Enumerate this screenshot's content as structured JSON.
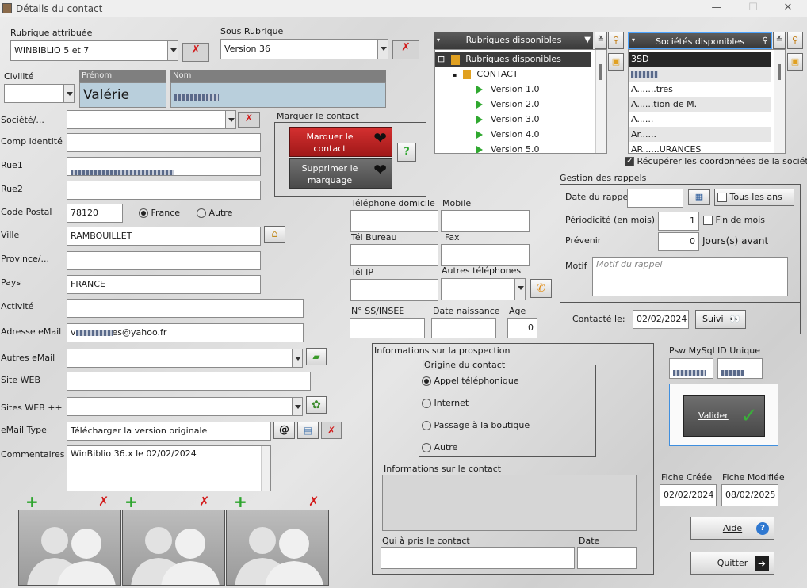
{
  "window": {
    "title": "Détails du contact"
  },
  "rubrique": {
    "label": "Rubrique attribuée",
    "value": "WINBIBLIO 5 et 7"
  },
  "sous_rubrique": {
    "label": "Sous Rubrique",
    "value": "Version 36"
  },
  "civilite": {
    "label": "Civilité",
    "value": ""
  },
  "prenom": {
    "label": "Prénom",
    "value": "Valérie"
  },
  "nom": {
    "label": "Nom"
  },
  "marquer": {
    "group_label": "Marquer le contact",
    "mark_btn": "Marquer le contact",
    "unmark_btn": "Supprimer le marquage",
    "help": "?"
  },
  "fields": {
    "societe": "Société/...",
    "comp_identite": "Comp identité",
    "rue1": "Rue1",
    "rue2": "Rue2",
    "code_postal": "Code Postal",
    "code_postal_value": "78120",
    "france": "France",
    "autre": "Autre",
    "ville": "Ville",
    "ville_value": "RAMBOUILLET",
    "province": "Province/...",
    "pays": "Pays",
    "pays_value": "FRANCE",
    "activite": "Activité",
    "email": "Adresse eMail",
    "email_value_suffix": "es@yahoo.fr",
    "autres_email": "Autres eMail",
    "site_web": "Site WEB",
    "sites_web": "Sites WEB ++",
    "email_type": "eMail Type",
    "email_type_value": "Télécharger la version originale",
    "commentaires": "Commentaires",
    "commentaires_value": "WinBiblio 36.x le 02/02/2024"
  },
  "phones": {
    "tel_domicile": "Téléphone domicile",
    "mobile": "Mobile",
    "tel_bureau": "Tél Bureau",
    "fax": "Fax",
    "tel_ip": "Tél IP",
    "autres_tel": "Autres téléphones",
    "ss": "N° SS/INSEE",
    "date_naissance": "Date naissance",
    "age": "Age",
    "age_value": "0"
  },
  "rubriques_panel": {
    "header": "Rubriques disponibles",
    "root": "Rubriques disponibles",
    "node": "CONTACT",
    "items": [
      "Version 1.0",
      "Version 2.0",
      "Version 3.0",
      "Version 4.0",
      "Version 5.0"
    ]
  },
  "societes_panel": {
    "header": "Sociétés disponibles",
    "items": [
      "3SD",
      "",
      "A.......tres",
      "A......tion de M.",
      "A......",
      "Ar......",
      "AR......URANCES"
    ]
  },
  "recuperer": "Récupérer les coordonnées de la société",
  "rappels": {
    "title": "Gestion des rappels",
    "date_label": "Date du rappel",
    "tous_les_ans": "Tous les ans",
    "periodicite": "Périodicité (en mois)",
    "periodicite_value": "1",
    "fin_de_mois": "Fin de mois",
    "prevenir": "Prévenir",
    "prevenir_value": "0",
    "jours_avant": "Jours(s) avant",
    "motif": "Motif",
    "motif_placeholder": "Motif du rappel",
    "contacte_le": "Contacté le:",
    "contacte_value": "02/02/2024",
    "suivi": "Suivi"
  },
  "prospection": {
    "title": "Informations sur la prospection",
    "origine": "Origine du contact",
    "options": [
      "Appel téléphonique",
      "Internet",
      "Passage à la boutique",
      "Autre"
    ],
    "info_contact": "Informations sur le contact",
    "qui": "Qui à pris le contact",
    "date": "Date"
  },
  "psw": {
    "label": "Psw MySql",
    "id_label": "ID Unique"
  },
  "valider": "Valider",
  "fiche": {
    "creee_label": "Fiche Créée",
    "creee_value": "02/02/2024",
    "modifiee_label": "Fiche Modifiée",
    "modifiee_value": "08/02/2025"
  },
  "aide": "Aide",
  "quitter": "Quitter"
}
